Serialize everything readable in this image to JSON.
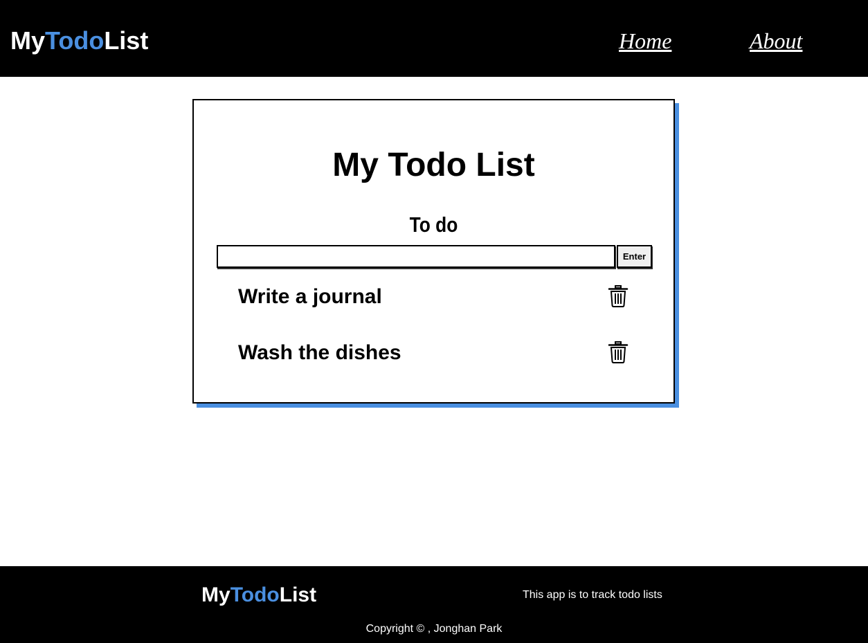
{
  "header": {
    "logo": {
      "part1": "My",
      "part2": "Todo",
      "part3": "List"
    },
    "nav": {
      "home": "Home",
      "about": "About"
    }
  },
  "card": {
    "title": "My Todo List",
    "section_label": "To do",
    "input": {
      "value": "",
      "placeholder": ""
    },
    "enter_label": "Enter",
    "items": [
      {
        "text": "Write a journal",
        "icon": "trash-icon"
      },
      {
        "text": "Wash the dishes",
        "icon": "trash-icon"
      }
    ]
  },
  "footer": {
    "logo": {
      "part1": "My",
      "part2": "Todo",
      "part3": "List"
    },
    "description": "This app is to track todo lists",
    "copyright": "Copyright © , Jonghan Park"
  },
  "colors": {
    "accent": "#4a8fe0",
    "bar": "#000000",
    "background": "#ffffff"
  }
}
